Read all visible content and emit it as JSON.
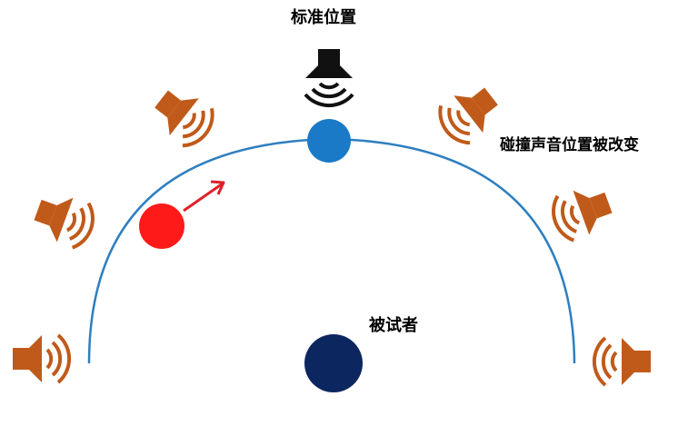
{
  "labels": {
    "standard_position": "标准位置",
    "collision_changed": "碰撞声音位置被改变",
    "subject": "被试者"
  },
  "colors": {
    "arc": "#2f7fc0",
    "speaker_orange": "#c05a1a",
    "speaker_black": "#111111",
    "dot_blue": "#1a7ac8",
    "dot_red": "#ff1a1a",
    "subject_navy": "#0c2660",
    "arrow_red": "#e0202a"
  },
  "icons": {
    "speaker": "speaker-icon",
    "arrow": "arrow-icon"
  }
}
